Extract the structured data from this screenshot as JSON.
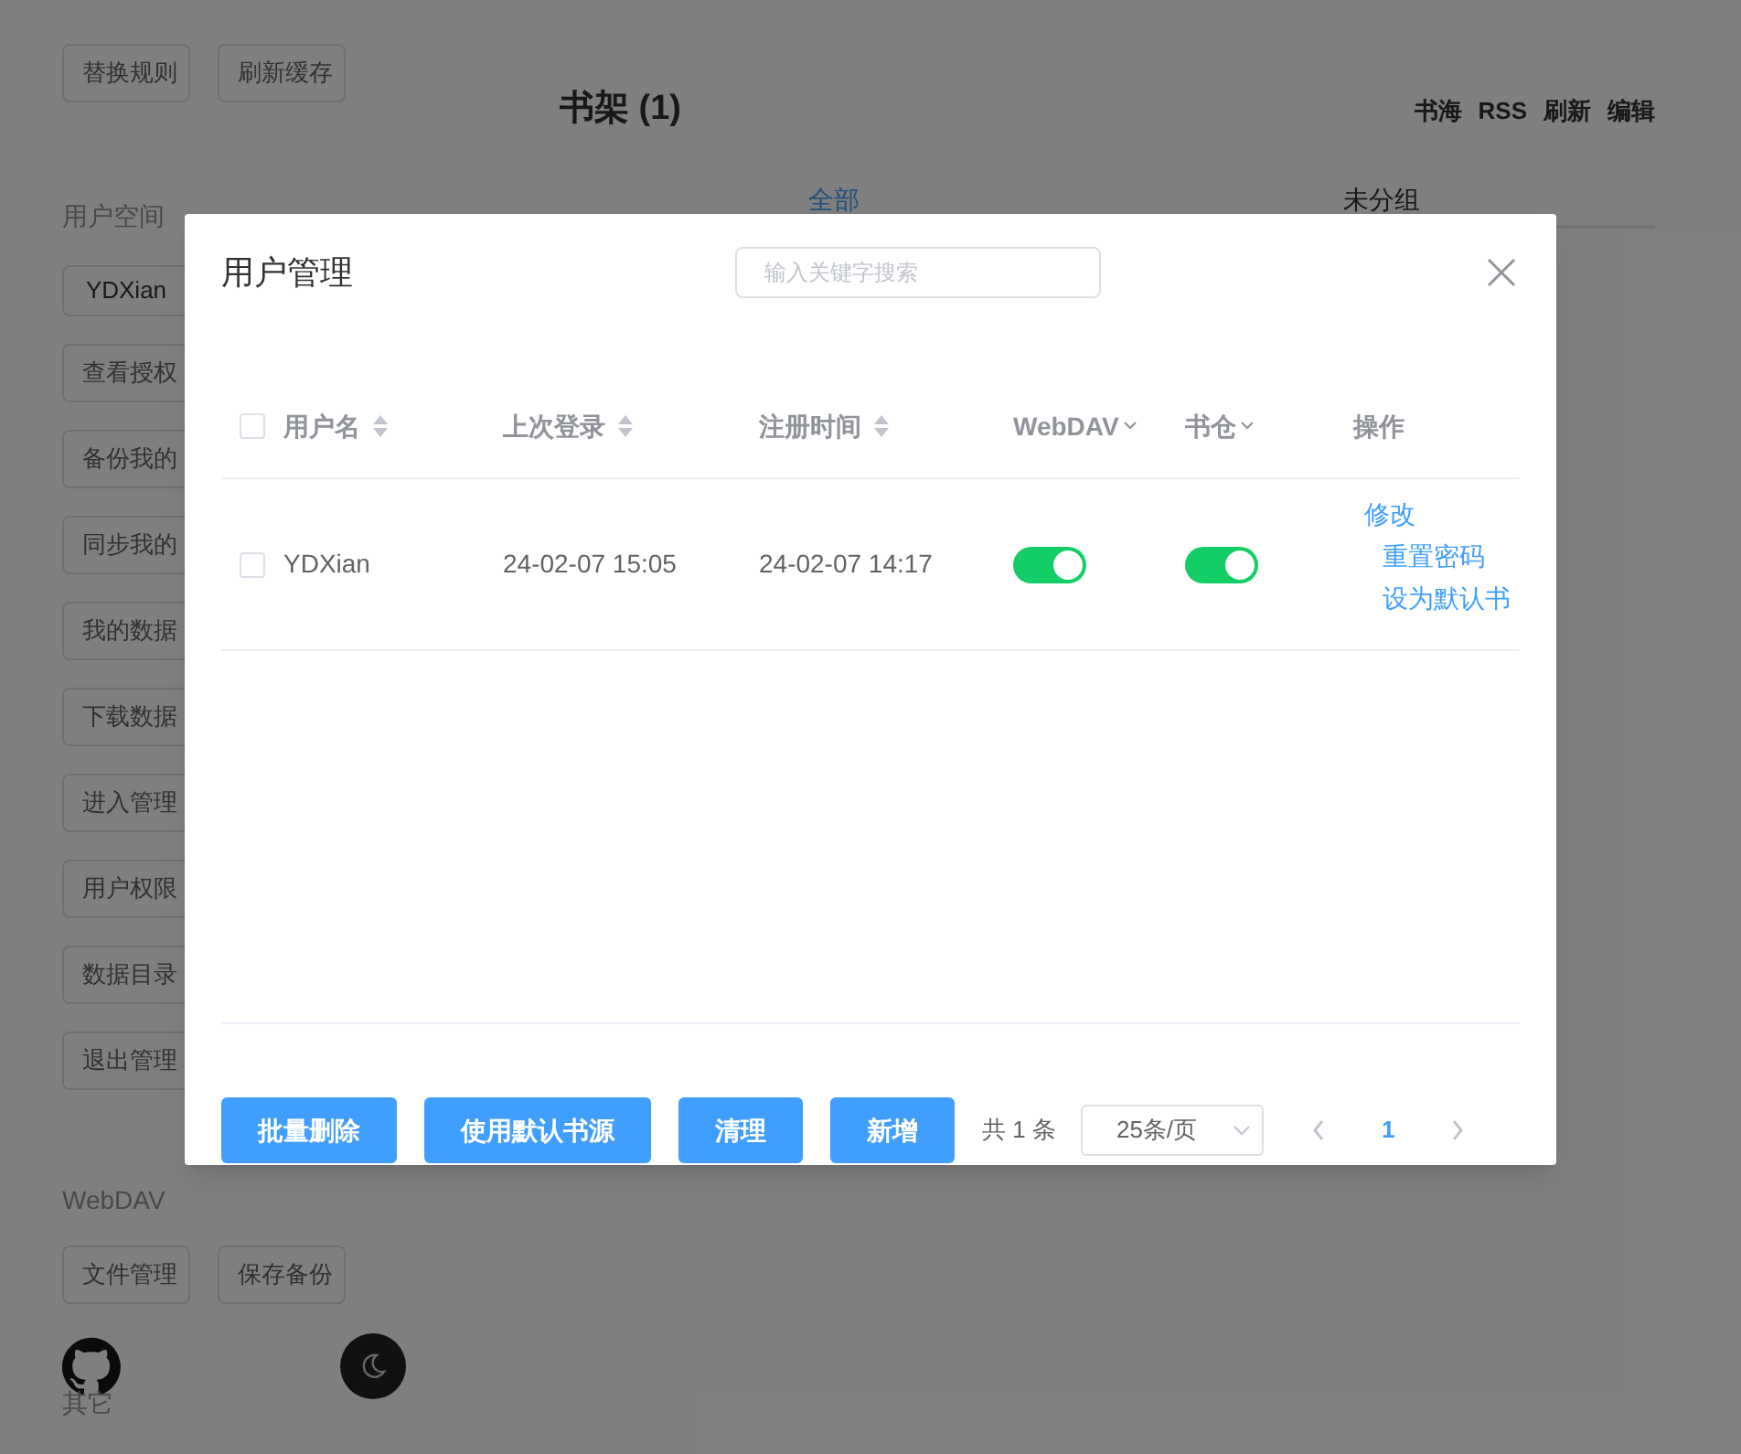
{
  "sidebar": {
    "top_buttons": [
      "替换规则",
      "刷新缓存"
    ],
    "user_space": {
      "title": "用户空间",
      "username": "YDXian",
      "buttons": [
        "查看授权",
        "备份我的",
        "同步我的",
        "我的数据",
        "下载数据",
        "进入管理",
        "用户权限",
        "数据目录",
        "退出管理"
      ]
    },
    "webdav": {
      "title": "WebDAV",
      "buttons": [
        "文件管理",
        "保存备份"
      ]
    },
    "other": {
      "title": "其它"
    }
  },
  "shelf": {
    "title": "书架 (1)",
    "actions": [
      "书海",
      "RSS",
      "刷新",
      "编辑"
    ],
    "tabs": [
      {
        "label": "全部",
        "selected": true
      },
      {
        "label": "未分组",
        "selected": false
      }
    ]
  },
  "dialog": {
    "title": "用户管理",
    "search": {
      "placeholder": "输入关键字搜索"
    },
    "all_checked": false,
    "columns": [
      {
        "label": "用户名",
        "kind": "sort"
      },
      {
        "label": "上次登录",
        "kind": "sort"
      },
      {
        "label": "注册时间",
        "kind": "sort"
      },
      {
        "label": "WebDAV",
        "kind": "filter"
      },
      {
        "label": "书仓",
        "kind": "filter"
      },
      {
        "label": "操作",
        "kind": "plain"
      }
    ],
    "rows": [
      {
        "checked": false,
        "username": "YDXian",
        "last_login": "24-02-07 15:05",
        "registered": "24-02-07 14:17",
        "webdav_on": true,
        "bookstore_on": true,
        "actions": [
          "修改",
          "重置密码",
          "设为默认书"
        ]
      }
    ],
    "buttons": [
      "批量删除",
      "使用默认书源",
      "清理",
      "新增"
    ],
    "total": "共 1 条",
    "page_size": "25条/页",
    "pages": [
      {
        "label": "1",
        "selected": true
      }
    ]
  }
}
